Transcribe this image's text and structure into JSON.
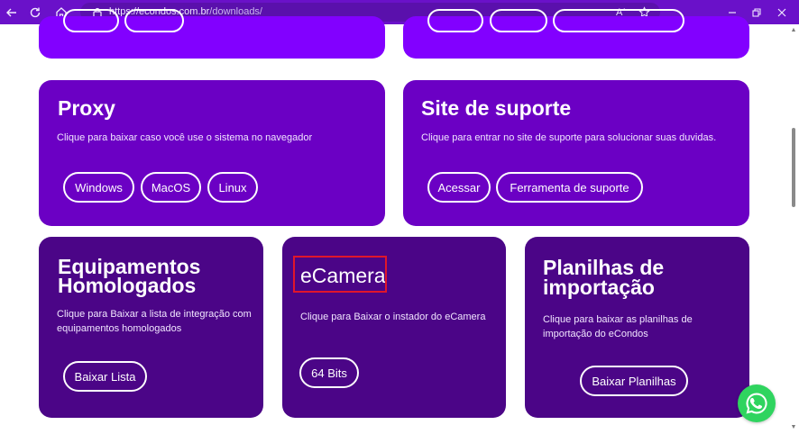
{
  "browser": {
    "url_host": "https://econdos.com.br",
    "url_path": "/downloads/",
    "read_aloud_glyph": "Aʾ"
  },
  "cards": {
    "top_left": {
      "buttons": [
        "",
        ""
      ]
    },
    "top_right": {
      "buttons": [
        "",
        "",
        ""
      ]
    },
    "proxy": {
      "title": "Proxy",
      "description": "Clique para baixar caso você use o sistema no navegador",
      "buttons": [
        "Windows",
        "MacOS",
        "Linux"
      ]
    },
    "support": {
      "title": "Site de suporte",
      "description": "Clique para entrar no site de suporte para solucionar suas duvidas.",
      "buttons": [
        "Acessar",
        "Ferramenta de suporte"
      ]
    },
    "equip": {
      "title_line1": "Equipamentos",
      "title_line2": "Homologados",
      "description_line1": "Clique para Baixar a lista de integração com",
      "description_line2": "equipamentos homologados",
      "button": "Baixar Lista"
    },
    "ecamera": {
      "title": "eCamera",
      "description": "Clique para Baixar o instador do eCamera",
      "button": "64 Bits"
    },
    "planilhas": {
      "title_line1": "Planilhas de",
      "title_line2": "importação",
      "description_line1": "Clique para baixar as planilhas de",
      "description_line2": "importação do eCondos",
      "button": "Baixar Planilhas"
    }
  },
  "colors": {
    "browser_bar": "#6a11c9",
    "card_violet": "#6b00c4",
    "card_deep": "#4b0587",
    "card_bright": "#8200ff",
    "highlight": "#e0162b",
    "whatsapp": "#2fd45f"
  },
  "icons": [
    "back-arrow-icon",
    "refresh-icon",
    "home-icon",
    "lock-icon",
    "read-aloud-icon",
    "favorite-star-icon",
    "minimize-icon",
    "restore-icon",
    "close-icon",
    "whatsapp-icon"
  ]
}
